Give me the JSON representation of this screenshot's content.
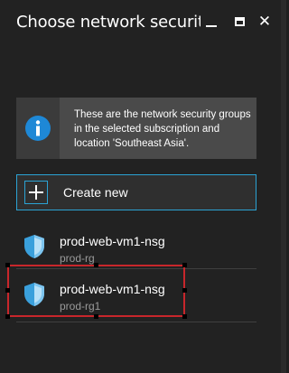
{
  "window": {
    "title": "Choose network security...",
    "controls": [
      "minimize-icon",
      "maximize-icon",
      "close-icon"
    ],
    "close_glyph": "✕"
  },
  "info": {
    "icon": "info-icon",
    "text": "These are the network security groups in the selected subscription and location 'Southeast Asia'."
  },
  "create": {
    "icon": "plus-icon",
    "label": "Create new"
  },
  "items": [
    {
      "name": "prod-web-vm1-nsg",
      "resource_group": "prod-rg",
      "icon": "shield-icon"
    },
    {
      "name": "prod-web-vm1-nsg",
      "resource_group": "prod-rg1",
      "icon": "shield-icon",
      "highlighted": true
    }
  ],
  "colors": {
    "background": "#222222",
    "accent": "#2ba3d4",
    "info_box": "#4a4a4a",
    "highlight": "#c8262b",
    "subtext": "#9a9a9a"
  }
}
